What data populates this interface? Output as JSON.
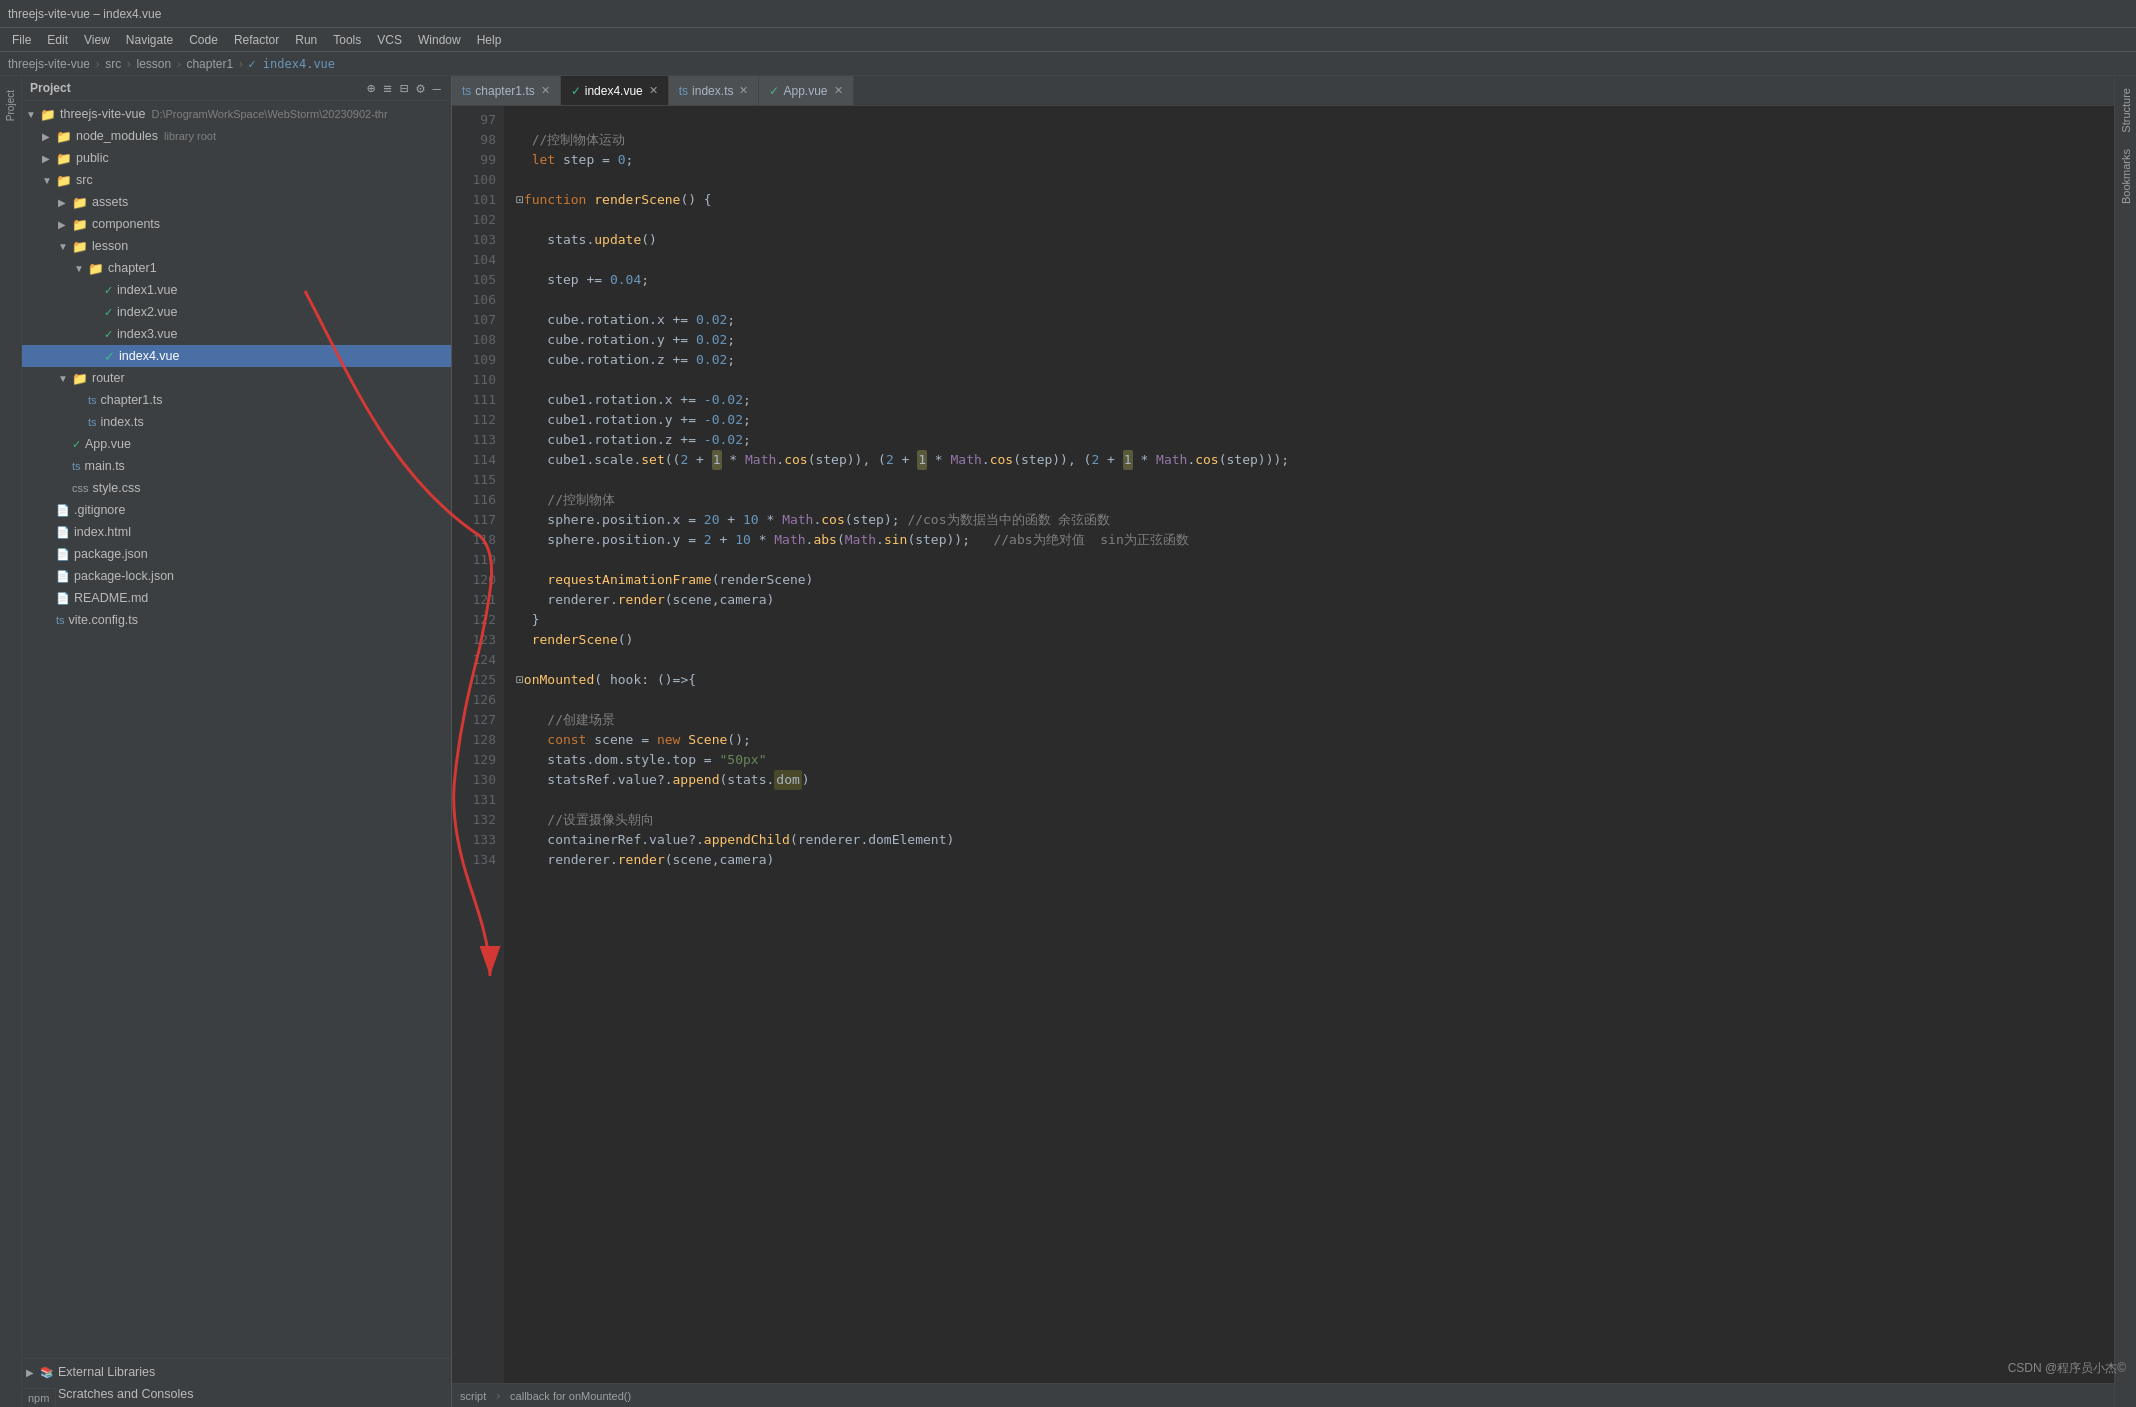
{
  "titlebar": {
    "text": "threejs-vite-vue – index4.vue"
  },
  "menubar": {
    "items": [
      "File",
      "Edit",
      "View",
      "Navigate",
      "Code",
      "Refactor",
      "Run",
      "Tools",
      "VCS",
      "Window",
      "Help"
    ]
  },
  "breadcrumb": {
    "items": [
      "threejs-vite-vue",
      "src",
      "lesson",
      "chapter1",
      "index4.vue"
    ]
  },
  "project": {
    "label": "Project",
    "root": "threejs-vite-vue",
    "root_path": "D:\\ProgramWorkSpace\\WebStorm\\20230902-thr",
    "tree": [
      {
        "id": "node_modules",
        "label": "node_modules",
        "badge": "library root",
        "indent": 1,
        "type": "folder",
        "expanded": false
      },
      {
        "id": "public",
        "label": "public",
        "indent": 1,
        "type": "folder",
        "expanded": false
      },
      {
        "id": "src",
        "label": "src",
        "indent": 1,
        "type": "folder",
        "expanded": true
      },
      {
        "id": "assets",
        "label": "assets",
        "indent": 2,
        "type": "folder",
        "expanded": false
      },
      {
        "id": "components",
        "label": "components",
        "indent": 2,
        "type": "folder",
        "expanded": false
      },
      {
        "id": "lesson",
        "label": "lesson",
        "indent": 2,
        "type": "folder",
        "expanded": true
      },
      {
        "id": "chapter1",
        "label": "chapter1",
        "indent": 3,
        "type": "folder",
        "expanded": true
      },
      {
        "id": "index1.vue",
        "label": "index1.vue",
        "indent": 4,
        "type": "vue"
      },
      {
        "id": "index2.vue",
        "label": "index2.vue",
        "indent": 4,
        "type": "vue"
      },
      {
        "id": "index3.vue",
        "label": "index3.vue",
        "indent": 4,
        "type": "vue"
      },
      {
        "id": "index4.vue",
        "label": "index4.vue",
        "indent": 4,
        "type": "vue",
        "selected": true
      },
      {
        "id": "router",
        "label": "router",
        "indent": 2,
        "type": "folder",
        "expanded": true
      },
      {
        "id": "chapter1.ts",
        "label": "chapter1.ts",
        "indent": 3,
        "type": "ts"
      },
      {
        "id": "index.ts2",
        "label": "index.ts",
        "indent": 3,
        "type": "ts"
      },
      {
        "id": "App.vue",
        "label": "App.vue",
        "indent": 2,
        "type": "vue"
      },
      {
        "id": "main.ts",
        "label": "main.ts",
        "indent": 2,
        "type": "ts"
      },
      {
        "id": "style.css",
        "label": "style.css",
        "indent": 2,
        "type": "css"
      },
      {
        "id": "gitignore",
        "label": ".gitignore",
        "indent": 1,
        "type": "file"
      },
      {
        "id": "index.html",
        "label": "index.html",
        "indent": 1,
        "type": "file"
      },
      {
        "id": "package.json",
        "label": "package.json",
        "indent": 1,
        "type": "file"
      },
      {
        "id": "package-lock.json",
        "label": "package-lock.json",
        "indent": 1,
        "type": "file"
      },
      {
        "id": "README.md",
        "label": "README.md",
        "indent": 1,
        "type": "file"
      },
      {
        "id": "vite.config.ts",
        "label": "vite.config.ts",
        "indent": 1,
        "type": "ts"
      }
    ],
    "bottom_items": [
      {
        "label": "External Libraries",
        "type": "special"
      },
      {
        "label": "Scratches and Consoles",
        "type": "special"
      }
    ]
  },
  "tabs": [
    {
      "label": "chapter1.ts",
      "type": "ts",
      "active": false
    },
    {
      "label": "index4.vue",
      "type": "vue",
      "active": true
    },
    {
      "label": "index.ts",
      "type": "ts",
      "active": false
    },
    {
      "label": "App.vue",
      "type": "vue",
      "active": false
    }
  ],
  "code": {
    "lines": [
      {
        "num": 97,
        "content": ""
      },
      {
        "num": 98,
        "content": "  //控制物体运动"
      },
      {
        "num": 99,
        "content": "  let step = 0;"
      },
      {
        "num": 100,
        "content": ""
      },
      {
        "num": 101,
        "content": "function renderScene() {"
      },
      {
        "num": 102,
        "content": ""
      },
      {
        "num": 103,
        "content": "    stats.update()"
      },
      {
        "num": 104,
        "content": ""
      },
      {
        "num": 105,
        "content": "    step += 0.04;"
      },
      {
        "num": 106,
        "content": ""
      },
      {
        "num": 107,
        "content": "    cube.rotation.x += 0.02;"
      },
      {
        "num": 108,
        "content": "    cube.rotation.y += 0.02;"
      },
      {
        "num": 109,
        "content": "    cube.rotation.z += 0.02;"
      },
      {
        "num": 110,
        "content": ""
      },
      {
        "num": 111,
        "content": "    cube1.rotation.x += -0.02;"
      },
      {
        "num": 112,
        "content": "    cube1.rotation.y += -0.02;"
      },
      {
        "num": 113,
        "content": "    cube1.rotation.z += -0.02;"
      },
      {
        "num": 114,
        "content": "    cube1.scale.set((2 + 1 * Math.cos(step)), (2 + 1 * Math.cos(step)), (2 + 1 * Math.cos(step)));"
      },
      {
        "num": 115,
        "content": ""
      },
      {
        "num": 116,
        "content": "    //控制物体"
      },
      {
        "num": 117,
        "content": "    sphere.position.x = 20 + 10 * Math.cos(step); //cos为数据当中的函数 余弦函数"
      },
      {
        "num": 118,
        "content": "    sphere.position.y = 2 + 10 * Math.abs(Math.sin(step));   //abs为绝对值  sin为正弦函数"
      },
      {
        "num": 119,
        "content": ""
      },
      {
        "num": 120,
        "content": "    requestAnimationFrame(renderScene)"
      },
      {
        "num": 121,
        "content": "    renderer.render(scene,camera)"
      },
      {
        "num": 122,
        "content": "  }"
      },
      {
        "num": 123,
        "content": "  renderScene()"
      },
      {
        "num": 124,
        "content": ""
      },
      {
        "num": 125,
        "content": "  onMounted( hook: ()=>{"
      },
      {
        "num": 126,
        "content": ""
      },
      {
        "num": 127,
        "content": "    //创建场景"
      },
      {
        "num": 128,
        "content": "    const scene = new Scene();"
      },
      {
        "num": 129,
        "content": "    stats.dom.style.top = \"50px\""
      },
      {
        "num": 130,
        "content": "    statsRef.value?.append(stats.dom)"
      },
      {
        "num": 131,
        "content": ""
      },
      {
        "num": 132,
        "content": "    //设置摄像头朝向"
      },
      {
        "num": 133,
        "content": "    containerRef.value?.appendChild(renderer.domElement)"
      },
      {
        "num": 134,
        "content": "    renderer.render(scene,camera)"
      }
    ]
  },
  "status_bar": {
    "script_label": "script",
    "callback_label": "callback for onMounted()"
  },
  "watermark": "CSDN @程序员小杰©",
  "side_labels": {
    "structure": "Structure",
    "bookmarks": "Bookmarks",
    "project_tab": "Project"
  }
}
